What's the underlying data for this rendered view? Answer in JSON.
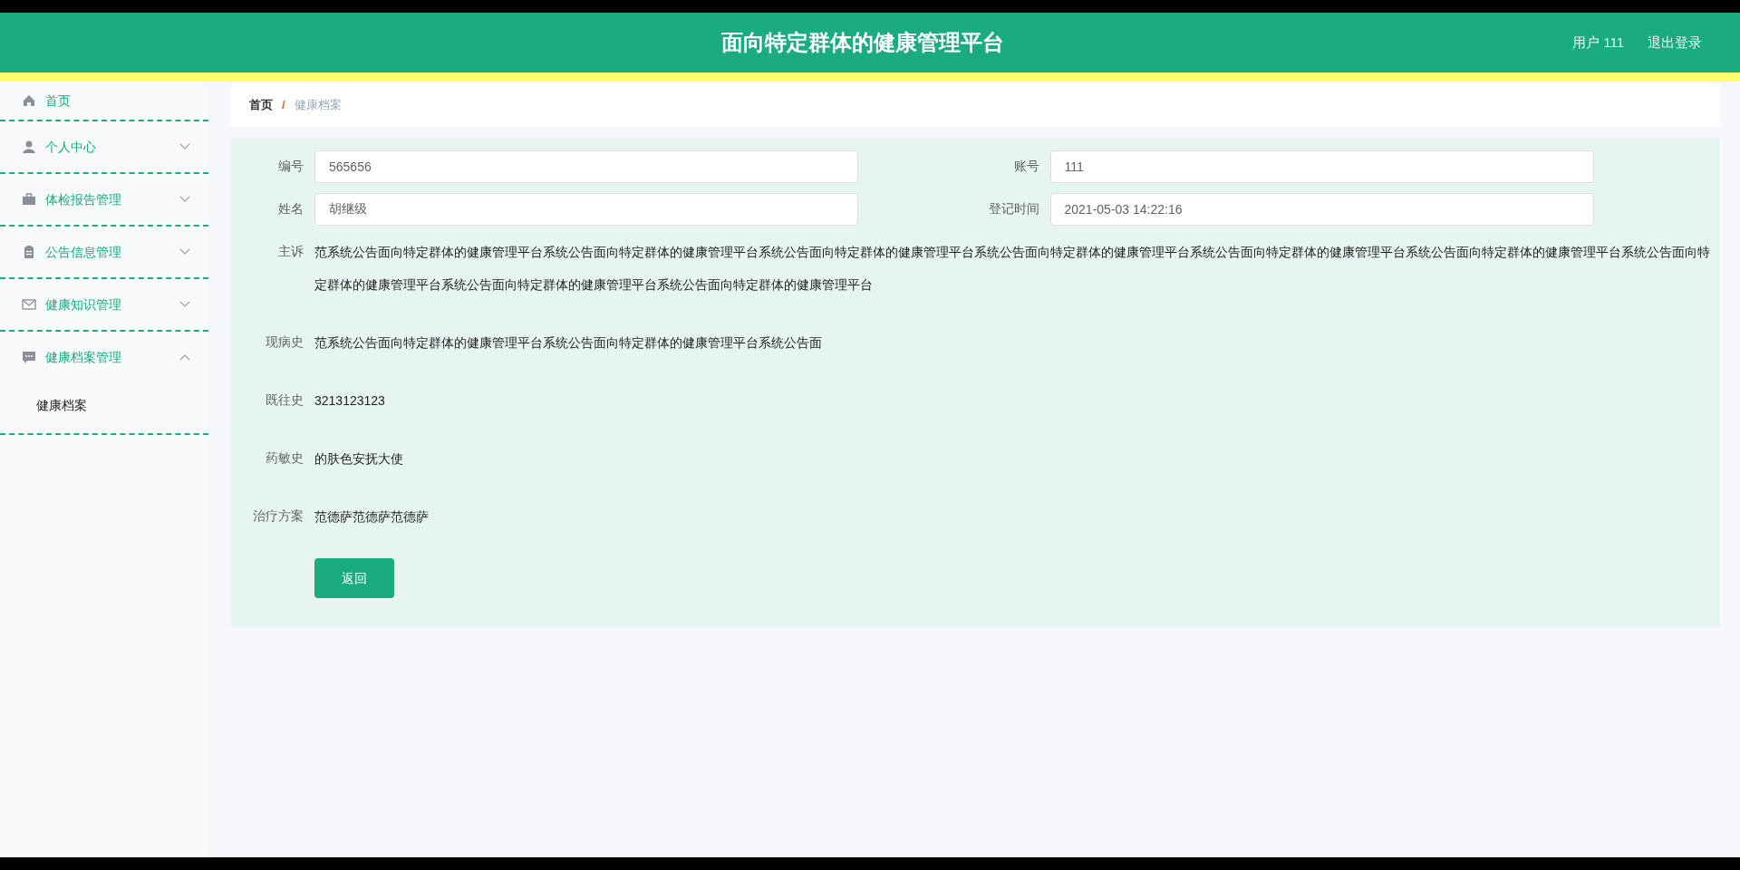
{
  "header": {
    "title": "面向特定群体的健康管理平台",
    "user": "用户 111",
    "logout": "退出登录"
  },
  "sidebar": {
    "items": [
      {
        "label": "首页",
        "kind": "link"
      },
      {
        "label": "个人中心",
        "kind": "submenu",
        "expanded": false
      },
      {
        "label": "体检报告管理",
        "kind": "submenu",
        "expanded": false
      },
      {
        "label": "公告信息管理",
        "kind": "submenu",
        "expanded": false
      },
      {
        "label": "健康知识管理",
        "kind": "submenu",
        "expanded": false
      },
      {
        "label": "健康档案管理",
        "kind": "submenu",
        "expanded": true,
        "children": [
          {
            "label": "健康档案"
          }
        ]
      }
    ]
  },
  "breadcrumb": {
    "separator": "/",
    "items": [
      "首页",
      "健康档案"
    ]
  },
  "form": {
    "fields": [
      {
        "label": "编号",
        "value": "565656",
        "kind": "input"
      },
      {
        "label": "账号",
        "value": "111",
        "kind": "input"
      },
      {
        "label": "姓名",
        "value": "胡继级",
        "kind": "input"
      },
      {
        "label": "登记时间",
        "value": "2021-05-03 14:22:16",
        "kind": "input"
      },
      {
        "label": "主诉",
        "value": "范系统公告面向特定群体的健康管理平台系统公告面向特定群体的健康管理平台系统公告面向特定群体的健康管理平台系统公告面向特定群体的健康管理平台系统公告面向特定群体的健康管理平台系统公告面向特定群体的健康管理平台系统公告面向特定群体的健康管理平台系统公告面向特定群体的健康管理平台系统公告面向特定群体的健康管理平台",
        "kind": "text"
      },
      {
        "label": "现病史",
        "value": "范系统公告面向特定群体的健康管理平台系统公告面向特定群体的健康管理平台系统公告面",
        "kind": "text"
      },
      {
        "label": "既往史",
        "value": "3213123123",
        "kind": "text"
      },
      {
        "label": "药敏史",
        "value": "的肤色安抚大使",
        "kind": "text"
      },
      {
        "label": "治疗方案",
        "value": "范德萨范德萨范德萨",
        "kind": "text"
      }
    ],
    "button": "返回"
  }
}
